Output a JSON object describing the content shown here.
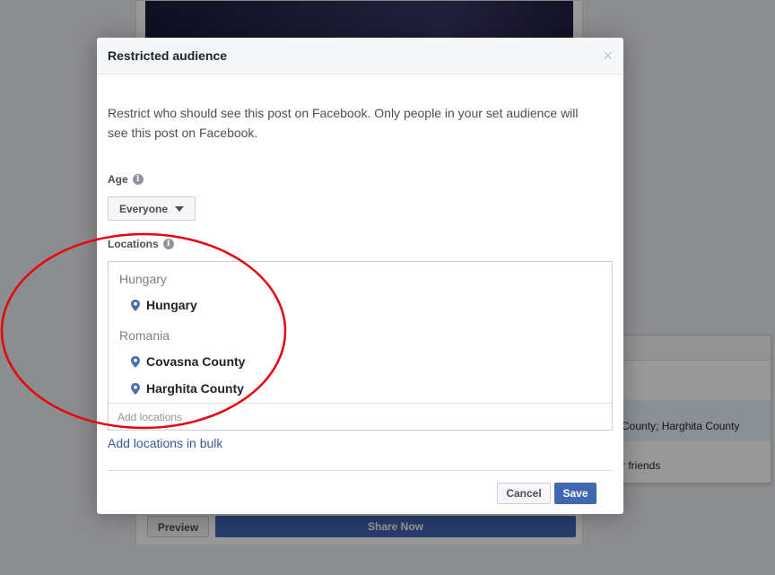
{
  "background": {
    "preview_label": "Preview",
    "share_label": "Share Now",
    "audience_selected": "County; Harghita County",
    "audience_friends": "r friends"
  },
  "modal": {
    "title": "Restricted audience",
    "close_symbol": "×",
    "description": "Restrict who should see this post on Facebook. Only people in your set audience will see this post on Facebook.",
    "age_label": "Age",
    "age_value": "Everyone",
    "locations_label": "Locations",
    "location_groups": [
      {
        "name": "Hungary",
        "items": [
          "Hungary"
        ]
      },
      {
        "name": "Romania",
        "items": [
          "Covasna County",
          "Harghita County"
        ]
      }
    ],
    "add_locations_placeholder": "Add locations",
    "bulk_link": "Add locations in bulk",
    "cancel_label": "Cancel",
    "save_label": "Save"
  },
  "icons": {
    "info": "info-icon",
    "pin": "location-pin-icon",
    "caret": "caret-down-icon",
    "close": "close-icon"
  },
  "colors": {
    "primary": "#4267b2",
    "link": "#365899",
    "annotation": "#e8000b"
  }
}
